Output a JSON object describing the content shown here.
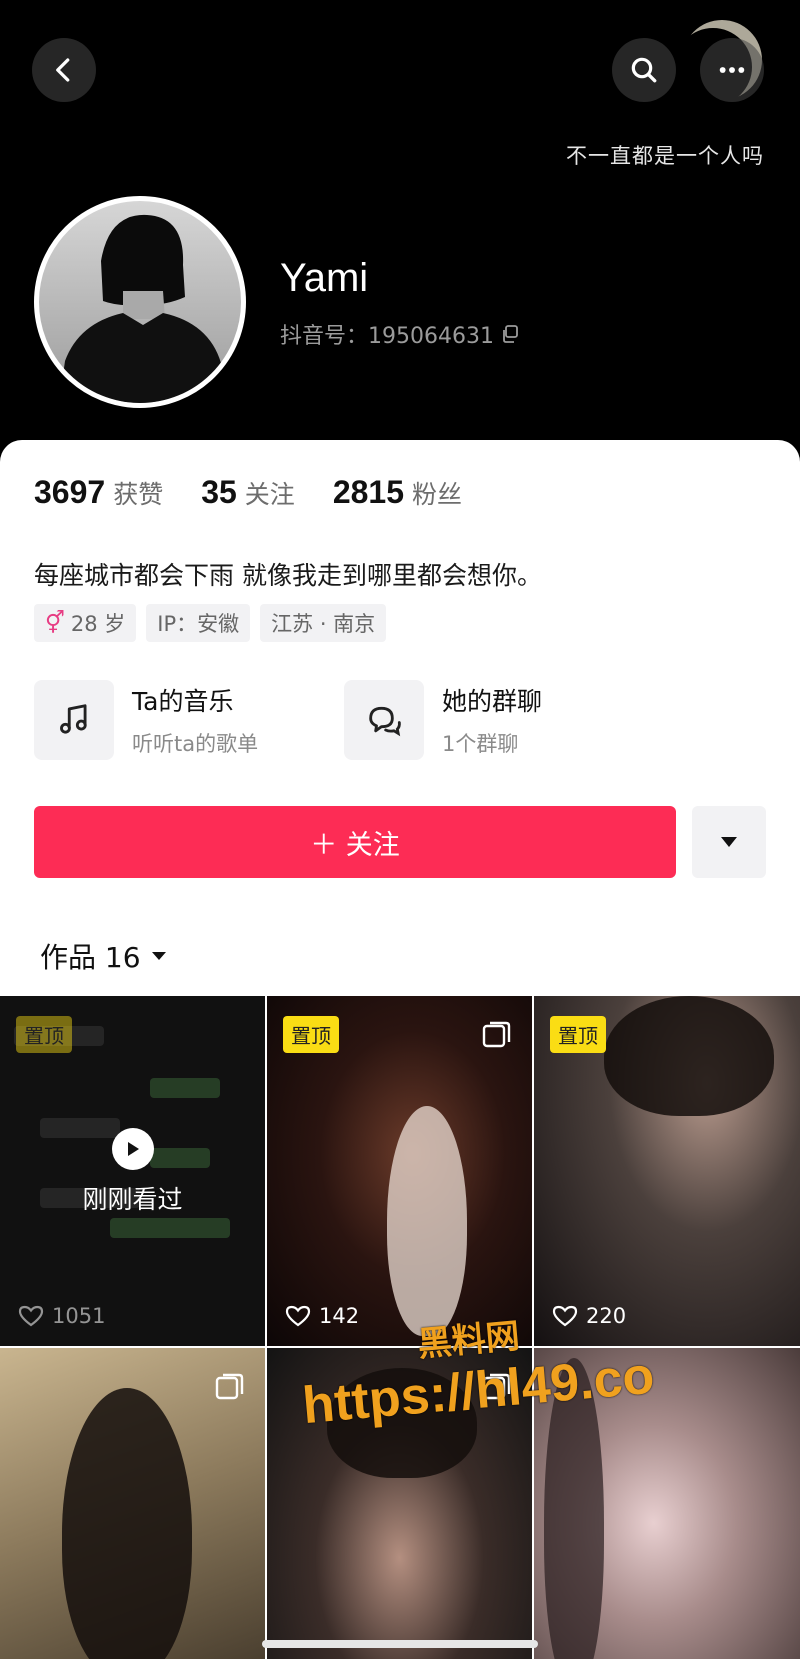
{
  "header": {
    "quote": "不一直都是一个人吗",
    "username": "Yami",
    "douyin_id": "抖音号：195064631"
  },
  "stats": [
    {
      "value": "3697",
      "label": "获赞"
    },
    {
      "value": "35",
      "label": "关注"
    },
    {
      "value": "2815",
      "label": "粉丝"
    }
  ],
  "bio": "每座城市都会下雨 就像我走到哪里都会想你。",
  "tags": {
    "gender_symbol": "⚥",
    "age": "28 岁",
    "ip": "IP：安徽",
    "location": "江苏 · 南京"
  },
  "features": {
    "music": {
      "title": "Ta的音乐",
      "subtitle": "听听ta的歌单"
    },
    "group": {
      "title": "她的群聊",
      "subtitle": "1个群聊"
    }
  },
  "follow_label": "＋ 关注",
  "works_tab": "作品 16",
  "videos": [
    {
      "pinned": "置顶",
      "likes": "1051",
      "recent": "刚刚看过"
    },
    {
      "pinned": "置顶",
      "likes": "142"
    },
    {
      "pinned": "置顶",
      "likes": "220"
    },
    {},
    {},
    {}
  ],
  "watermark": {
    "title": "黑料网",
    "url": "https://hl49.co"
  },
  "icons": [
    "back-icon",
    "search-icon",
    "more-icon",
    "copy-icon",
    "music-note-icon",
    "chat-group-icon",
    "caret-down-icon",
    "heart-icon",
    "play-icon",
    "multi-image-icon"
  ],
  "colors": {
    "follow": "#fd2c55",
    "pin": "#fadd14",
    "gender": "#e73c83"
  }
}
